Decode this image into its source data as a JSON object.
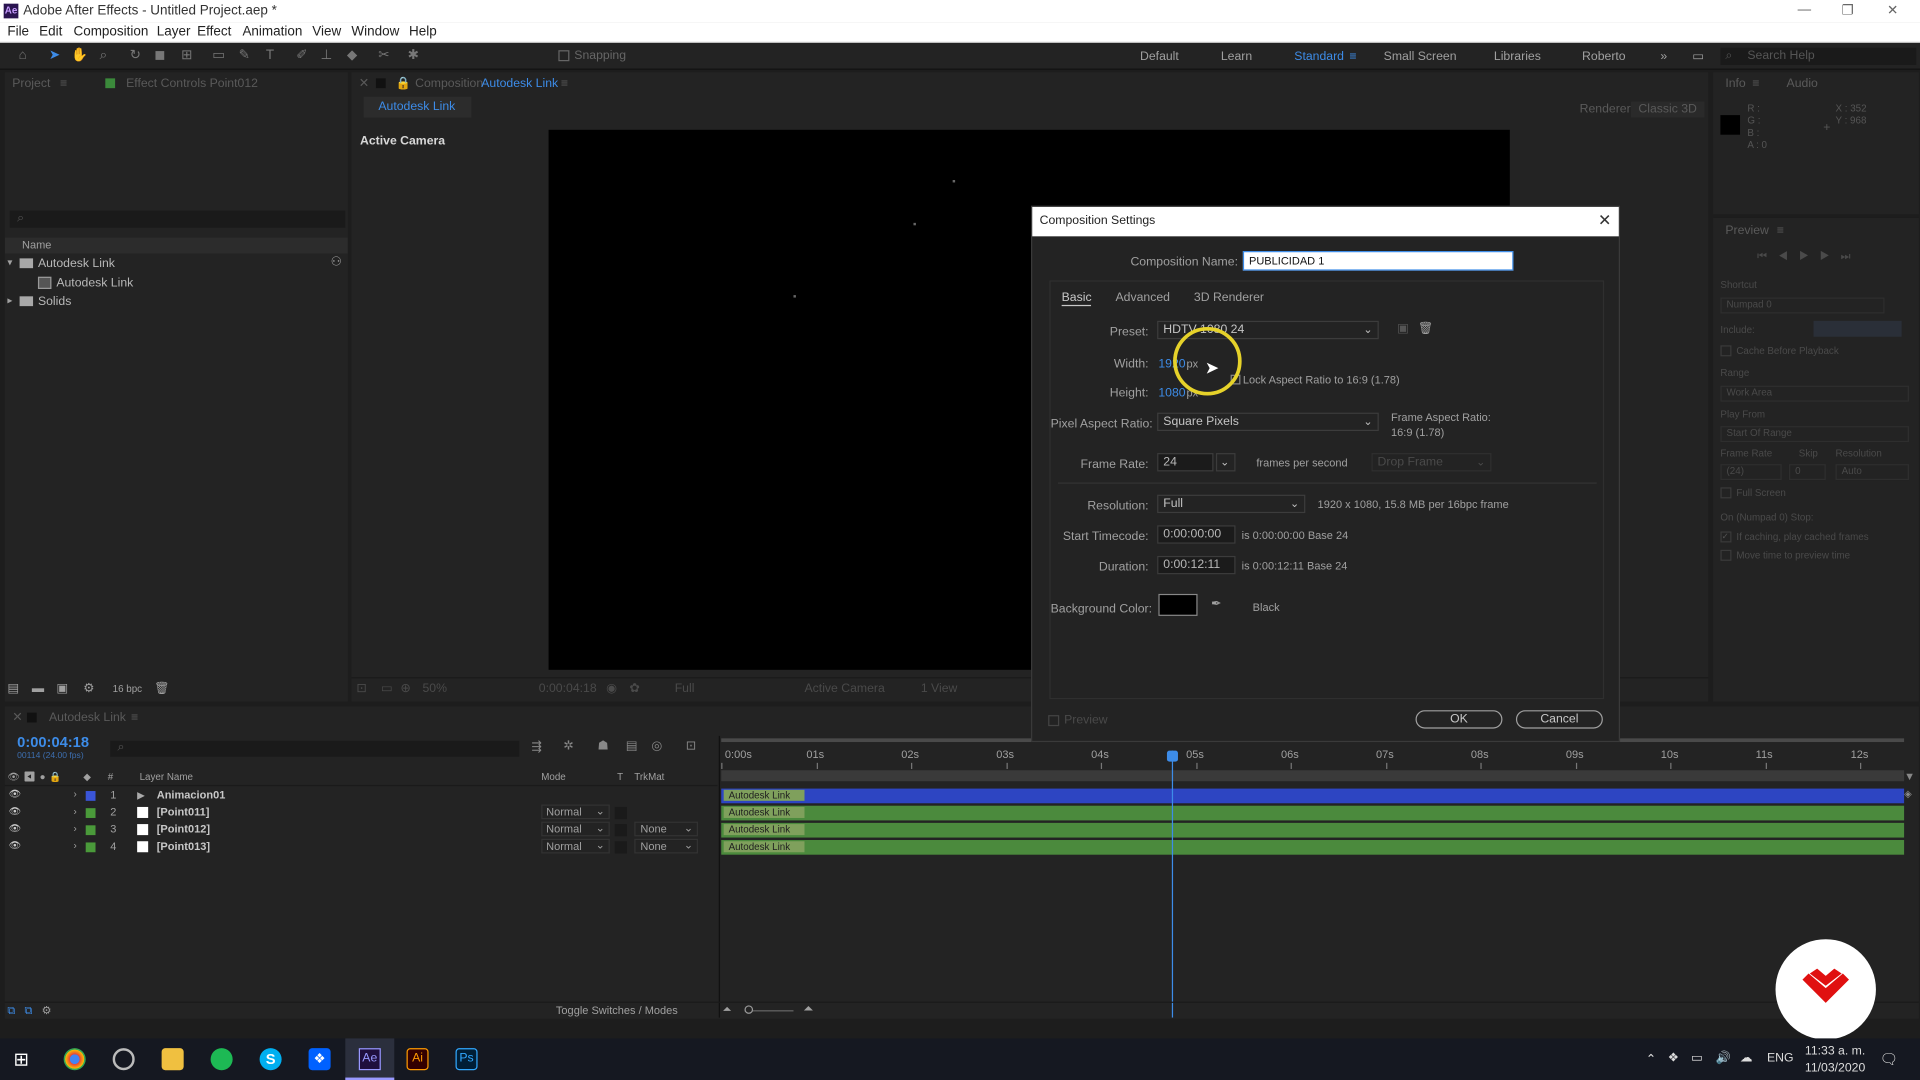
{
  "app": {
    "title": "Adobe After Effects - Untitled Project.aep *",
    "icon_text": "Ae"
  },
  "menu": [
    "File",
    "Edit",
    "Composition",
    "Layer",
    "Effect",
    "Animation",
    "View",
    "Window",
    "Help"
  ],
  "toolbar": {
    "snapping": "Snapping"
  },
  "workspaces": [
    "Default",
    "Learn",
    "Standard",
    "Small Screen",
    "Libraries",
    "Roberto"
  ],
  "search_help": "Search Help",
  "project_panel": {
    "tab_project": "Project",
    "tab_effect_controls": "Effect Controls Point012",
    "col_name": "Name",
    "items": [
      {
        "name": "Autodesk Link",
        "type": "folder"
      },
      {
        "name": "Autodesk Link",
        "type": "comp"
      },
      {
        "name": "Solids",
        "type": "folder"
      }
    ],
    "bpc": "16 bpc"
  },
  "comp_panel": {
    "tab_label": "Composition",
    "comp_name": "Autodesk Link",
    "subtab": "Autodesk Link",
    "view_label": "Active Camera",
    "renderer_label": "Renderer:",
    "renderer_value": "Classic 3D"
  },
  "viewer_footer": {
    "zoom": "50%",
    "timecode": "0:00:04:18",
    "resolution": "Full",
    "camera": "Active Camera",
    "views": "1 View"
  },
  "info_panel": {
    "tab_info": "Info",
    "tab_audio": "Audio",
    "rgba": [
      "R :",
      "G :",
      "B :",
      "A : 0"
    ],
    "x": "X : 352",
    "y": "Y : 968"
  },
  "preview_panel": {
    "title": "Preview",
    "shortcut_label": "Shortcut",
    "shortcut_value": "Numpad 0",
    "include_label": "Include:",
    "cache_label": "Cache Before Playback",
    "range_label": "Range",
    "range_value": "Work Area",
    "play_from_label": "Play From",
    "play_from_value": "Start Of Range",
    "frame_rate_label": "Frame Rate",
    "frame_rate_value": "(24)",
    "skip_label": "Skip",
    "skip_value": "0",
    "resolution_label": "Resolution",
    "resolution_value": "Auto",
    "full_screen_label": "Full Screen",
    "stop_label": "On (Numpad 0) Stop:",
    "cached_label": "If caching, play cached frames",
    "move_time_label": "Move time to preview time"
  },
  "dialog": {
    "title": "Composition Settings",
    "name_label": "Composition Name:",
    "name_value": "PUBLICIDAD 1",
    "tabs": [
      "Basic",
      "Advanced",
      "3D Renderer"
    ],
    "preset_label": "Preset:",
    "preset_value": "HDTV 1080 24",
    "width_label": "Width:",
    "width_value": "1920",
    "width_unit": "px",
    "height_label": "Height:",
    "height_value": "1080",
    "height_unit": "px",
    "lock_label": "Lock Aspect Ratio to 16:9 (1.78)",
    "par_label": "Pixel Aspect Ratio:",
    "par_value": "Square Pixels",
    "far_label": "Frame Aspect Ratio:",
    "far_value": "16:9 (1.78)",
    "fps_label": "Frame Rate:",
    "fps_value": "24",
    "fps_unit": "frames per second",
    "drop_frame": "Drop Frame",
    "res_label": "Resolution:",
    "res_value": "Full",
    "res_info": "1920 x 1080, 15.8 MB per 16bpc frame",
    "start_label": "Start Timecode:",
    "start_value": "0:00:00:00",
    "start_info": "is 0:00:00:00  Base 24",
    "dur_label": "Duration:",
    "dur_value": "0:00:12:11",
    "dur_info": "is 0:00:12:11  Base 24",
    "bg_label": "Background Color:",
    "bg_color": "#000000",
    "bg_name": "Black",
    "preview_label": "Preview",
    "ok": "OK",
    "cancel": "Cancel"
  },
  "timeline": {
    "tab": "Autodesk Link",
    "timecode": "0:00:04:18",
    "fps_info": "00114 (24.00 fps)",
    "cols": {
      "layer_name": "Layer Name",
      "mode": "Mode",
      "t": "T",
      "trkmat": "TrkMat",
      "num": "#"
    },
    "ruler": [
      "0:00s",
      "01s",
      "02s",
      "03s",
      "04s",
      "05s",
      "06s",
      "07s",
      "08s",
      "09s",
      "10s",
      "11s",
      "12s"
    ],
    "playhead_seconds": 4.75,
    "duration_seconds": 12.46,
    "layers": [
      {
        "num": "1",
        "name": "Animacion01",
        "mode": "",
        "trkmat": "",
        "color": "#3a55d8",
        "clip": "Autodesk Link",
        "bar": "#2d45c2"
      },
      {
        "num": "2",
        "name": "[Point011]",
        "mode": "Normal",
        "trkmat": "",
        "color": "#4a9a3a",
        "clip": "Autodesk Link",
        "bar": "#4b8a3d"
      },
      {
        "num": "3",
        "name": "[Point012]",
        "mode": "Normal",
        "trkmat": "None",
        "color": "#4a9a3a",
        "clip": "Autodesk Link",
        "bar": "#4b8a3d"
      },
      {
        "num": "4",
        "name": "[Point013]",
        "mode": "Normal",
        "trkmat": "None",
        "color": "#4a9a3a",
        "clip": "Autodesk Link",
        "bar": "#4b8a3d"
      }
    ],
    "toggle_label": "Toggle Switches / Modes"
  },
  "taskbar": {
    "lang": "ENG",
    "time": "11:33 a. m.",
    "date": "11/03/2020",
    "apps": [
      "windows-icon",
      "chrome-icon",
      "cortana-icon",
      "explorer-icon",
      "spotify-icon",
      "skype-icon",
      "dropbox-icon",
      "after-effects-icon",
      "illustrator-icon",
      "photoshop-icon"
    ],
    "ae_label": "Ae",
    "ai_label": "Ai",
    "ps_label": "Ps"
  }
}
